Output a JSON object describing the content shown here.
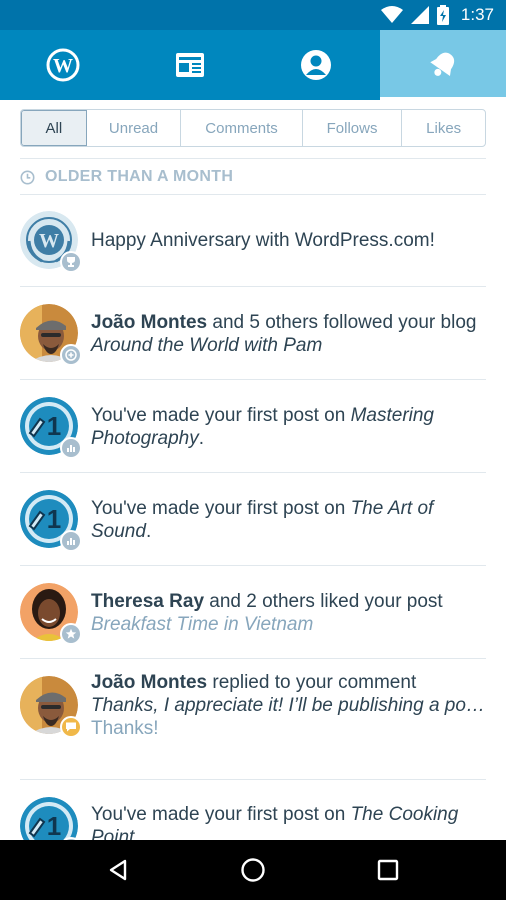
{
  "status_bar": {
    "time": "1:37",
    "icons": [
      "wifi-icon",
      "signal-icon",
      "battery-icon"
    ]
  },
  "top_tabs": [
    {
      "name": "tab-my-sites",
      "icon": "wordpress-logo-icon",
      "active": false
    },
    {
      "name": "tab-reader",
      "icon": "reader-icon",
      "active": false
    },
    {
      "name": "tab-me",
      "icon": "profile-icon",
      "active": false
    },
    {
      "name": "tab-notifications",
      "icon": "bell-icon",
      "active": true
    }
  ],
  "filters": {
    "all": "All",
    "unread": "Unread",
    "comments": "Comments",
    "follows": "Follows",
    "likes": "Likes",
    "selected": "All"
  },
  "section": {
    "title": "OLDER THAN A MONTH",
    "icon": "clock-icon"
  },
  "notifications": [
    {
      "text": "Happy Anniversary with WordPress.com!",
      "badge_icon": "trophy-icon"
    },
    {
      "name": "João Montes",
      "text": " and 5 others followed your blog ",
      "italic": "Around the World with Pam",
      "badge_icon": "follow-icon"
    },
    {
      "text": "You've made your first post on ",
      "italic": "Mastering Photography",
      "suffix": ".",
      "badge_icon": "stats-icon"
    },
    {
      "text": "You've made your first post on ",
      "italic": "The Art of Sound",
      "suffix": ".",
      "badge_icon": "stats-icon"
    },
    {
      "name": "Theresa Ray",
      "text": " and 2 others liked your post",
      "sub": "Breakfast Time in Vietnam",
      "badge_icon": "star-icon"
    },
    {
      "name": "João Montes",
      "text": " replied to your comment",
      "quote": "Thanks, I appreciate it! I’ll be publishing a po…",
      "reply": "Thanks!",
      "badge_icon": "comment-icon"
    },
    {
      "text": "You've made your first post on ",
      "italic": "The Cooking Point",
      "badge_icon": "stats-icon"
    }
  ],
  "colors": {
    "brand": "#0087be",
    "status": "#0073aa",
    "active_tab": "#78c8e6",
    "text": "#2e4453",
    "muted": "#87a6bc",
    "comment_badge": "#f0b849"
  }
}
